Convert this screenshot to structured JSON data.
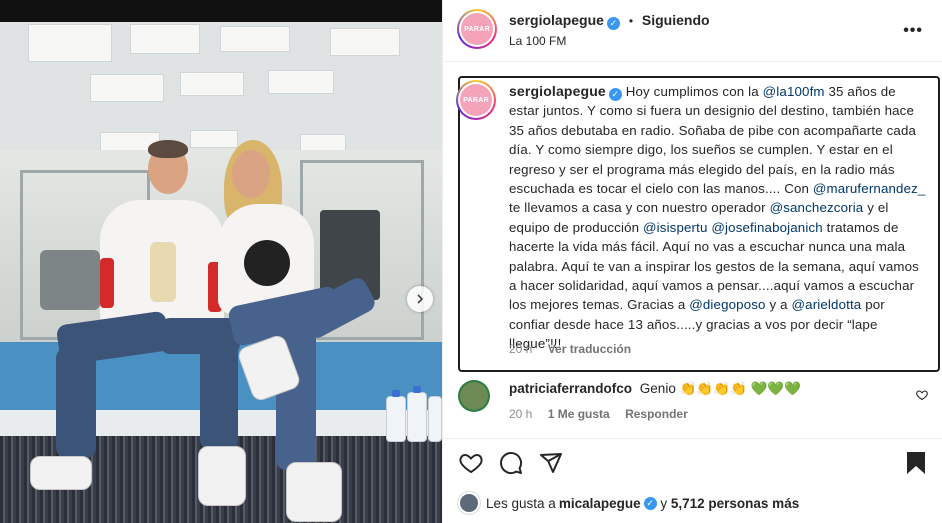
{
  "post": {
    "header": {
      "username": "sergiolapegue",
      "follow_label": "Siguiendo",
      "separator": "•",
      "location": "La 100 FM",
      "more_label": "•••"
    },
    "avatar_text": "PARAR",
    "caption": {
      "username": "sergiolapegue",
      "seg1": "Hoy cumplimos con la ",
      "mention1": "@la100fm",
      "seg2": " 35 años de estar juntos. Y como si fuera un designio del destino, también hace 35 años debutaba en radio. Soñaba de pibe con acompañarte cada día. Y como siempre digo, los sueños se cumplen. Y estar en el regreso y ser el programa más elegido del país, en la radio más escuchada es tocar el cielo con las manos.... Con ",
      "mention2": "@marufernandez_",
      "seg3": " te llevamos a casa y con nuestro operador ",
      "mention3": "@sanchezcoria",
      "seg4": " y el equipo de producción ",
      "mention4": "@isispertu",
      "seg5": " ",
      "mention5": "@josefinabojanich",
      "seg6": " tratamos de hacerte la vida más fácil. Aquí no vas a escuchar nunca una mala palabra. Aquí te van a inspirar los gestos de la semana, aquí vamos a hacer solidaridad, aquí vamos a pensar....aquí vamos a escuchar los mejores temas. Gracias a ",
      "mention6": "@diegoposo",
      "seg7": " y a ",
      "mention7": "@arieldotta",
      "seg8": " por confiar desde hace 13 años.....y gracias a vos por decir “lape llegue”!!!",
      "time": "20 h",
      "translate_label": "Ver traducción"
    },
    "comment": {
      "username": "patriciaferrandofco",
      "text": "Genio 👏👏👏👏 💚💚💚",
      "time": "20 h",
      "likes": "1 Me gusta",
      "reply_label": "Responder"
    },
    "likes": {
      "prefix": "Les gusta a ",
      "user": "micalapegue",
      "middle": " y ",
      "count": "5,712 personas más"
    }
  }
}
